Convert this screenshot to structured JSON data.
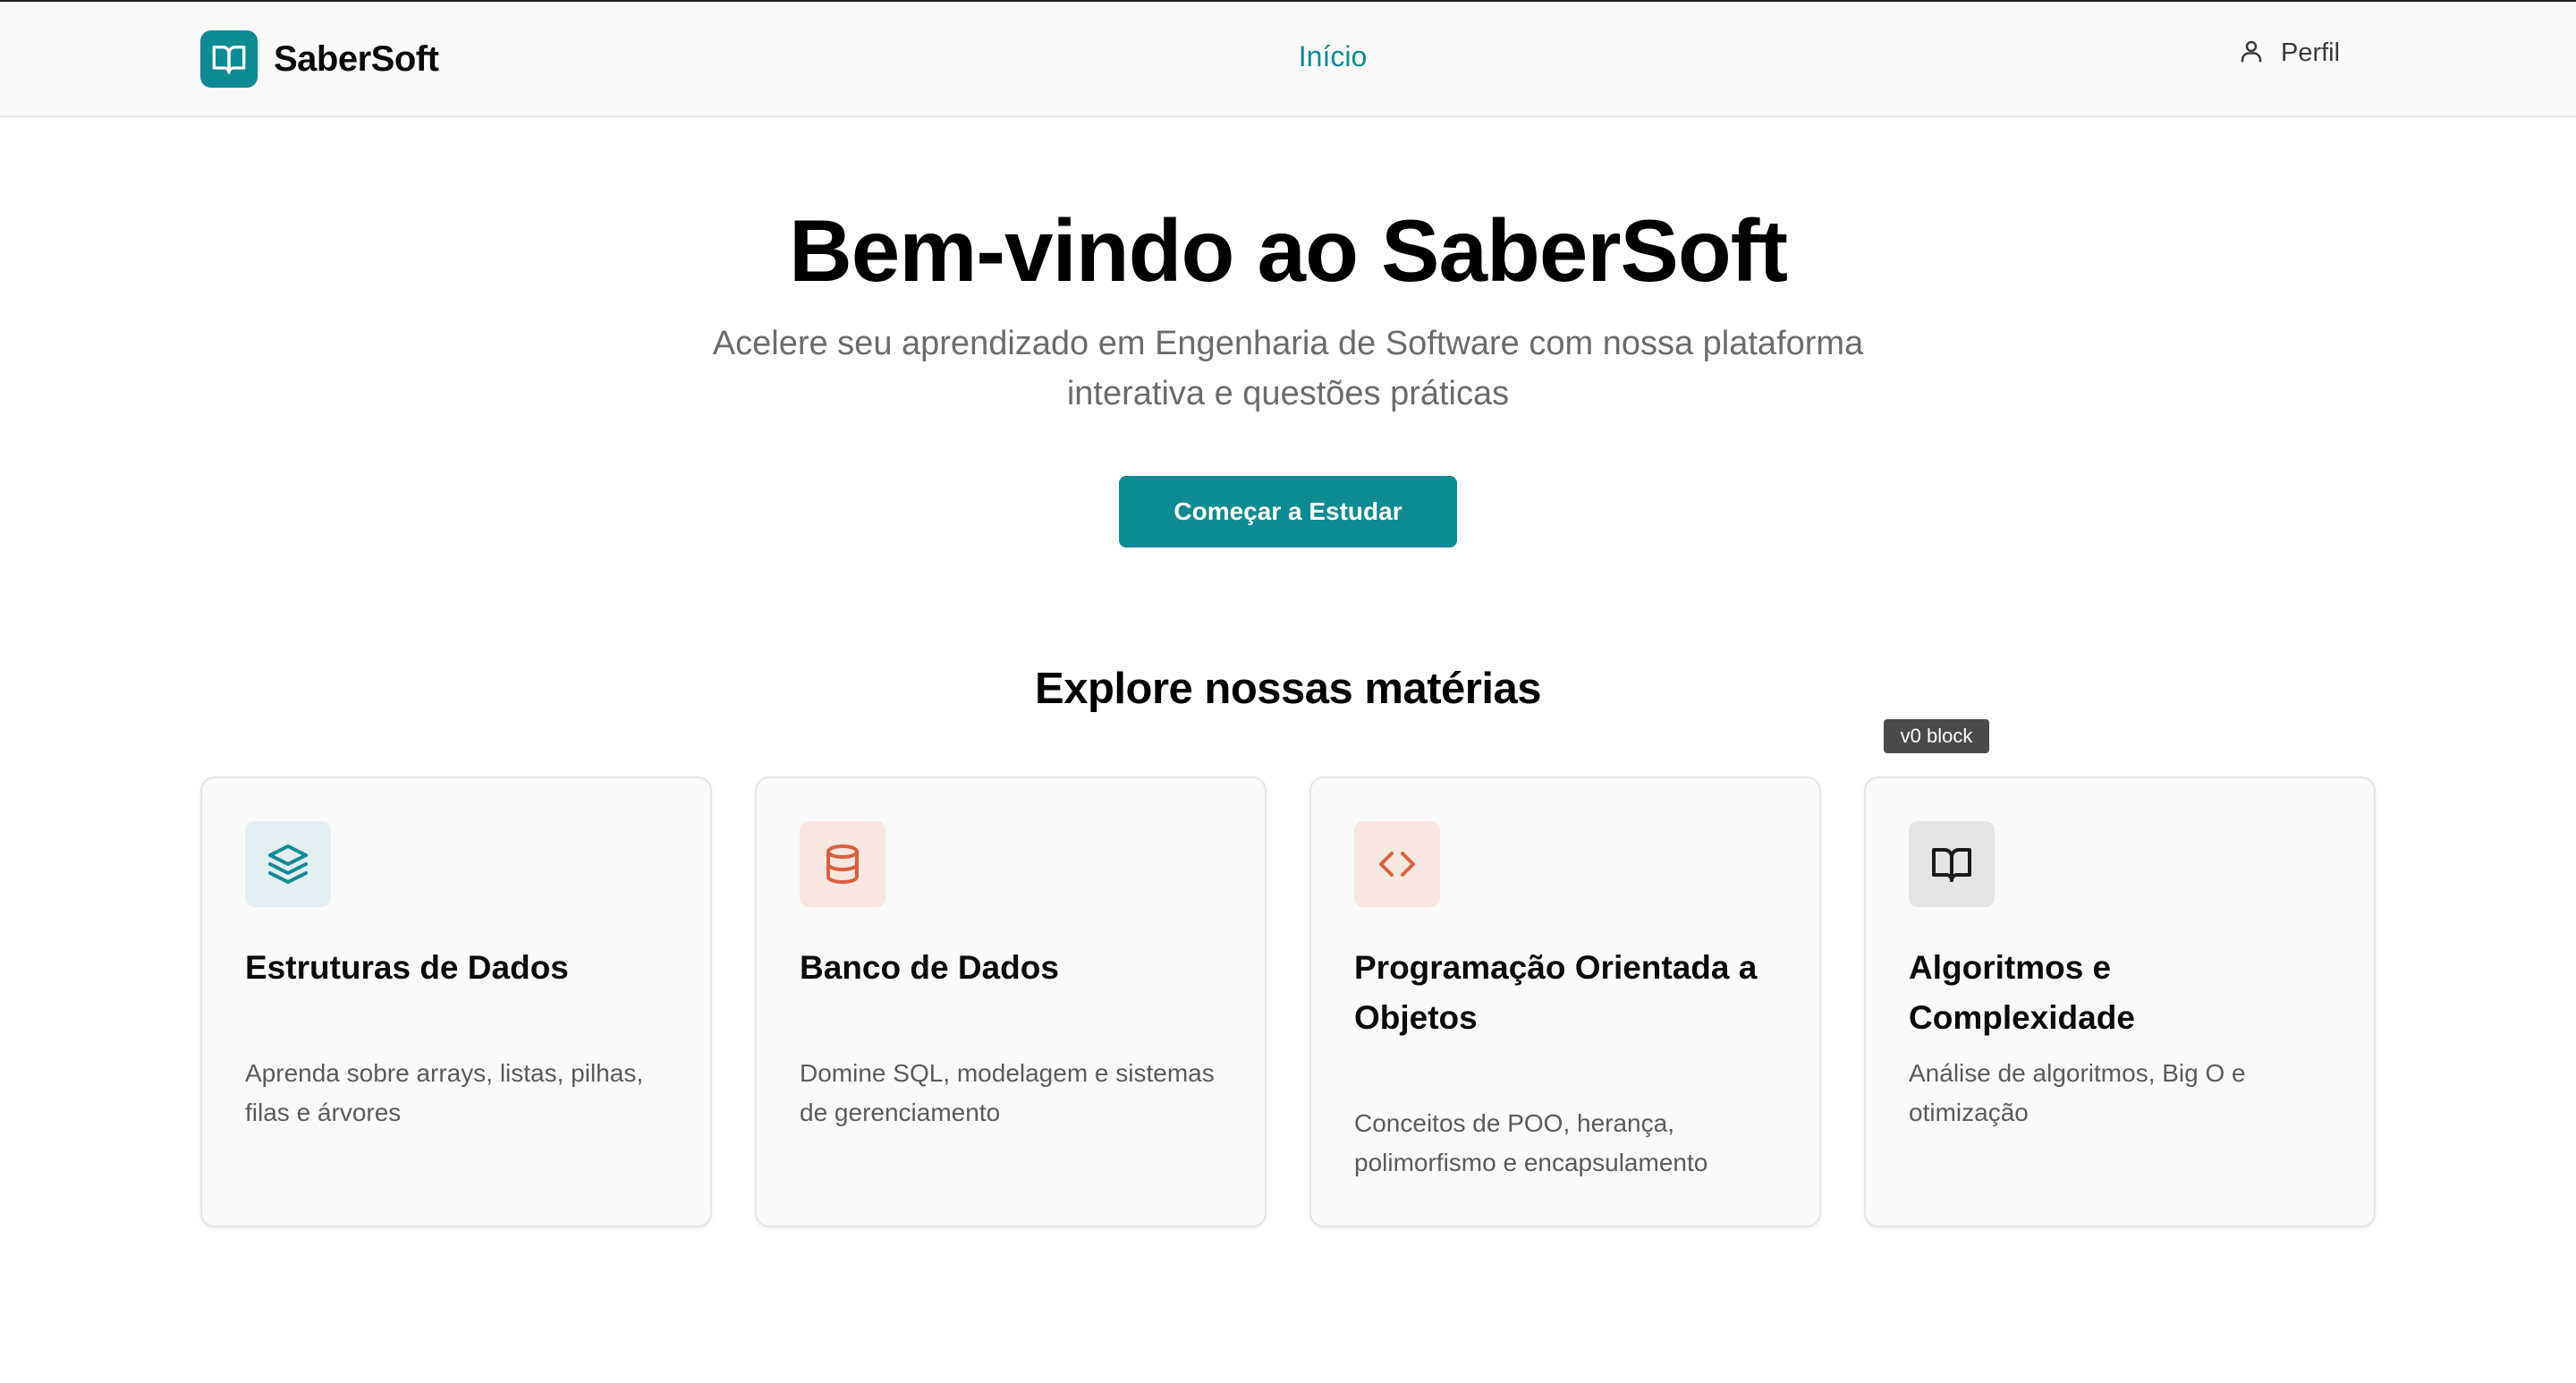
{
  "header": {
    "brand": "SaberSoft",
    "nav_home": "Início",
    "profile": "Perfil"
  },
  "hero": {
    "title": "Bem-vindo ao SaberSoft",
    "subtitle": "Acelere seu aprendizado em Engenharia de Software com nossa plataforma interativa e questões práticas",
    "cta": "Começar a Estudar"
  },
  "subjects": {
    "title": "Explore nossas matérias",
    "tooltip": "v0 block",
    "cards": [
      {
        "icon": "layers-icon",
        "title": "Estruturas de Dados",
        "description": "Aprenda sobre arrays, listas, pilhas, filas e árvores",
        "icon_color": "#0e8a92",
        "icon_bg": "#e3eff0"
      },
      {
        "icon": "database-icon",
        "title": "Banco de Dados",
        "description": "Domine SQL, modelagem e sistemas de gerenciamento",
        "icon_color": "#d9603b",
        "icon_bg": "#f8e7e1"
      },
      {
        "icon": "code-icon",
        "title": "Programação Orientada a Objetos",
        "description": "Conceitos de POO, herança, polimorfismo e encapsulamento",
        "icon_color": "#d9603b",
        "icon_bg": "#f8e7e1"
      },
      {
        "icon": "book-open-icon",
        "title": "Algoritmos e Complexidade",
        "description": "Análise de algoritmos, Big O e otimização",
        "icon_color": "#1a1a1a",
        "icon_bg": "#e5e5e5"
      }
    ]
  },
  "colors": {
    "primary": "#0e8a92",
    "accent_orange": "#d9603b",
    "text_muted": "#6b6b6b"
  }
}
